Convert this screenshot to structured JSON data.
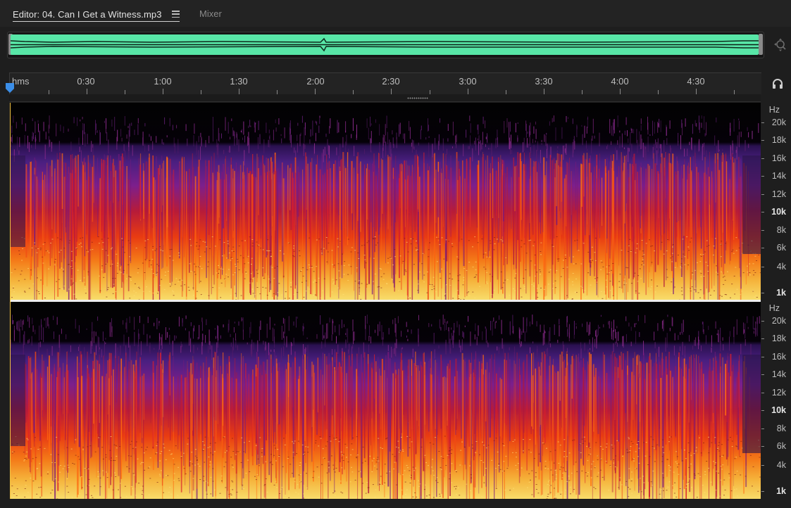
{
  "tabs": {
    "editor_label": "Editor: 04. Can I Get a Witness.mp3",
    "mixer_label": "Mixer"
  },
  "icons": {
    "menu": "hamburger-menu-icon",
    "zoom": "zoom-navigator-icon",
    "headphones": "headphones-icon",
    "playhead": "playhead-marker-icon"
  },
  "colors": {
    "overview_waveform": "#58e6a7",
    "playhead": "#3b8ee8"
  },
  "timeline": {
    "labels": [
      "hms",
      "0:30",
      "1:00",
      "1:30",
      "2:00",
      "2:30",
      "3:00",
      "3:30",
      "4:00",
      "4:30"
    ]
  },
  "frequency_ruler": {
    "unit": "Hz",
    "labels": [
      "20k",
      "18k",
      "16k",
      "14k",
      "12k",
      "10k",
      "8k",
      "6k",
      "4k",
      "1k"
    ]
  }
}
